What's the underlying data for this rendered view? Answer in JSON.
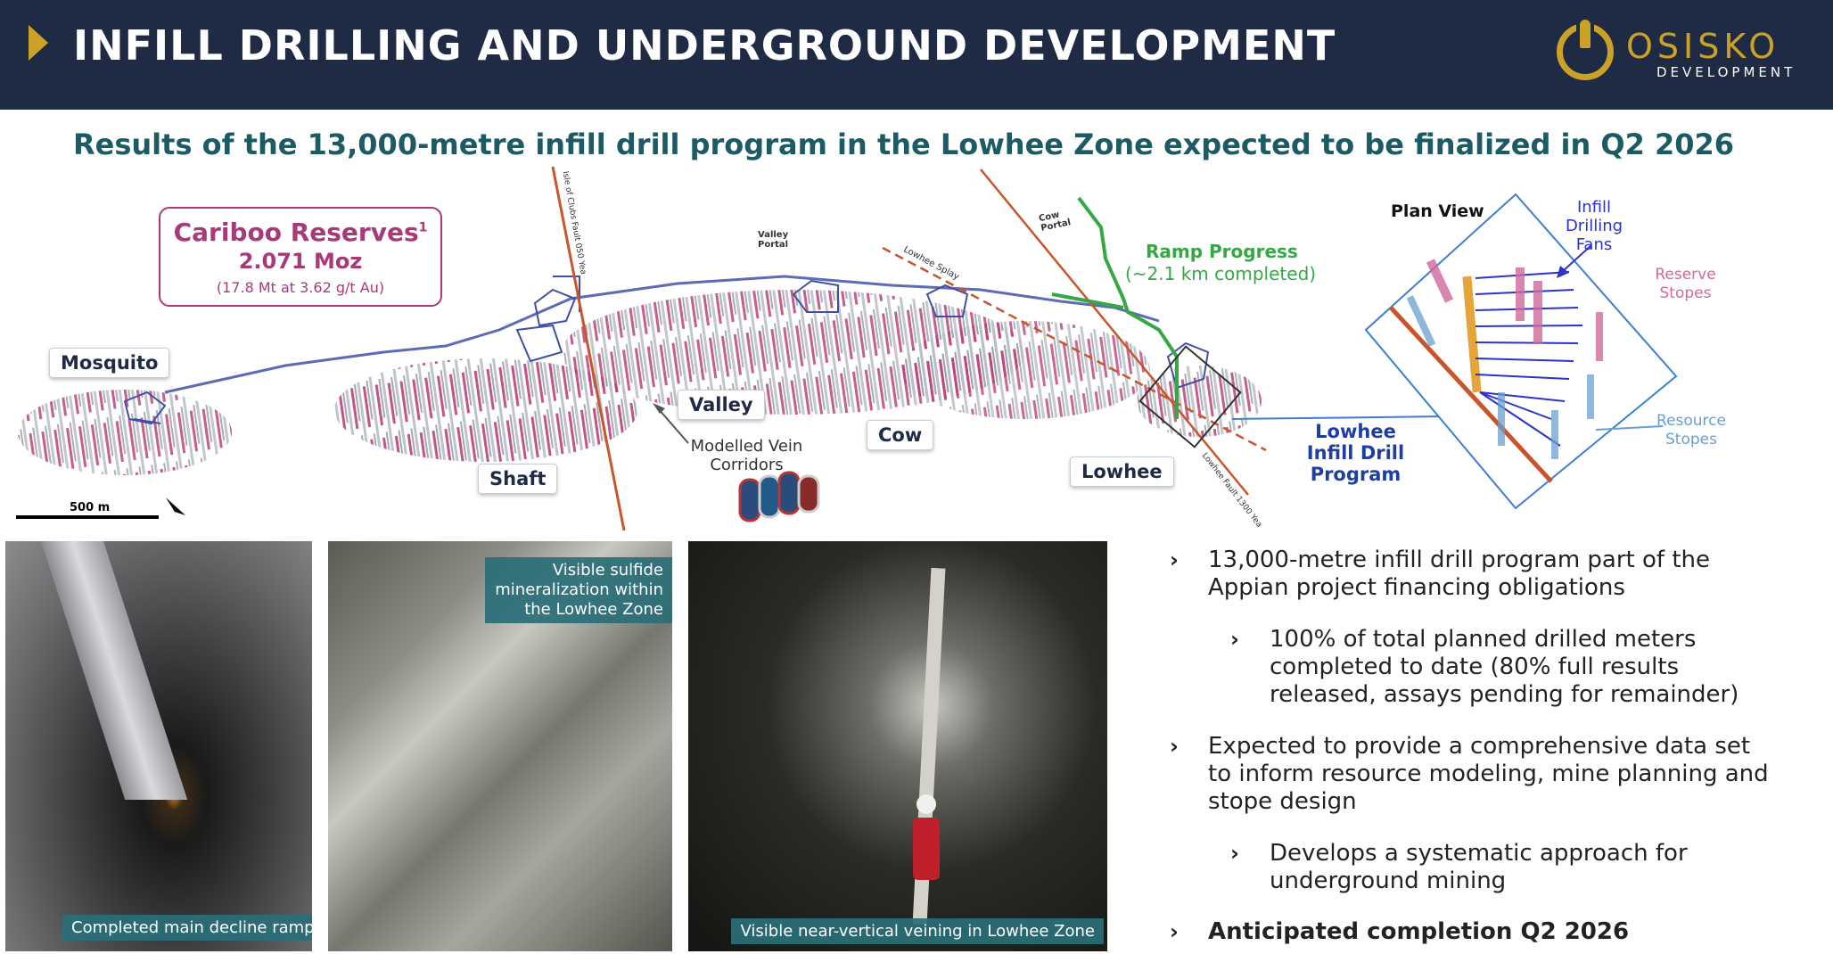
{
  "header": {
    "title": "INFILL DRILLING AND UNDERGROUND DEVELOPMENT",
    "logo_name": "OSISKO",
    "logo_sub": "DEVELOPMENT",
    "colors": {
      "navy": "#1f2a44",
      "gold": "#c9a227"
    }
  },
  "subtitle": "Results of the 13,000-metre infill drill program in the Lowhee Zone expected to be finalized in Q2 2026",
  "map": {
    "reserves": {
      "title": "Cariboo Reserves",
      "footnote": "1",
      "value": "2.071 Moz",
      "detail": "(17.8 Mt at 3.62 g/t Au)"
    },
    "zones": {
      "mosquito": "Mosquito",
      "shaft": "Shaft",
      "valley": "Valley",
      "cow": "Cow",
      "lowhee": "Lowhee"
    },
    "vein_corridors": "Modelled Vein Corridors",
    "ramp_progress": "Ramp Progress",
    "ramp_detail": "(~2.1 km completed)",
    "lowhee_program": "Lowhee Infill Drill Program",
    "scale": "500 m",
    "small_labels": {
      "valley_portal": "Valley Portal",
      "cow_portal": "Cow Portal",
      "lowhee_splay": "Lowhee Splay",
      "fault_left": "Isle of Clubs Fault 050 Yea",
      "fault_right": "Lowhee Fault 1300 Yea"
    },
    "plan_view": {
      "title": "Plan View",
      "infill": "Infill Drilling Fans",
      "reserve_stopes": "Reserve Stopes",
      "resource_stopes": "Resource Stopes"
    }
  },
  "photos": {
    "ramp_caption": "Completed main decline ramp",
    "sulfide_caption": "Visible sulfide mineralization within the Lowhee Zone",
    "veining_caption": "Visible near-vertical veining in Lowhee Zone"
  },
  "bullets": {
    "b1": "13,000-metre infill drill program part of the Appian project financing obligations",
    "b1_sub": "100% of total planned drilled meters completed to date (80% full results released, assays pending for remainder)",
    "b2": "Expected to provide a comprehensive data set to inform resource modeling, mine planning and stope design",
    "b2_sub": "Develops a systematic approach for underground mining",
    "b3": "Anticipated completion Q2 2026"
  }
}
